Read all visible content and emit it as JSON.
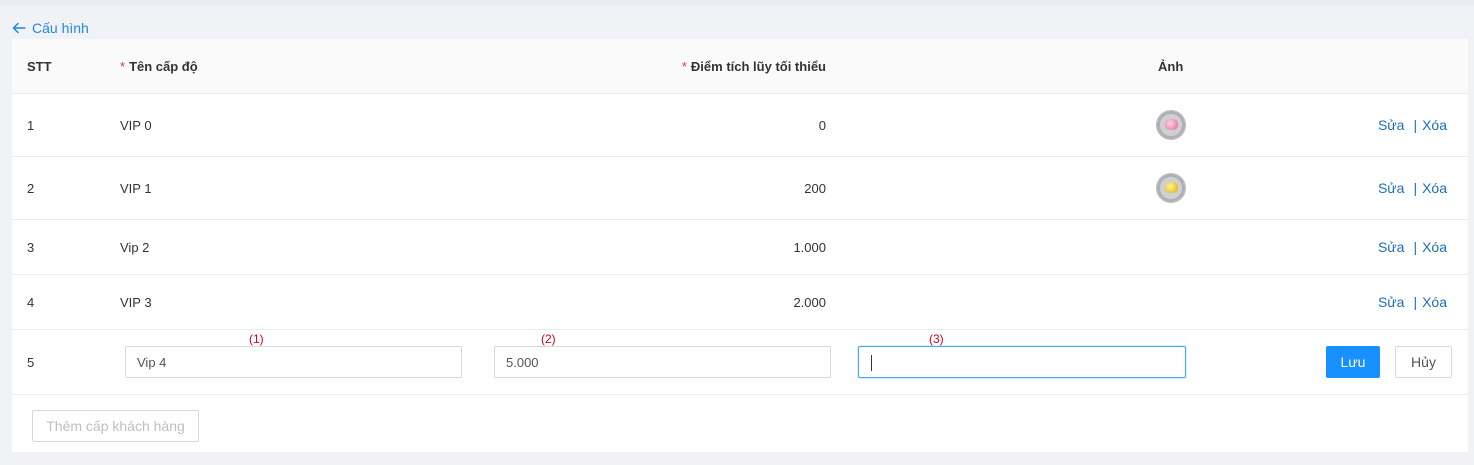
{
  "nav": {
    "back_label": "Cấu hình"
  },
  "table": {
    "headers": {
      "stt": "STT",
      "name": "Tên cấp độ",
      "points": "Điểm tích lũy tối thiểu",
      "image": "Ảnh",
      "required_mark": "*"
    },
    "rows": [
      {
        "stt": "1",
        "name": "VIP 0",
        "points": "0",
        "image": "pink-gem-icon",
        "edit": "Sửa",
        "delete": "Xóa"
      },
      {
        "stt": "2",
        "name": "VIP 1",
        "points": "200",
        "image": "gold-gem-icon",
        "edit": "Sửa",
        "delete": "Xóa"
      },
      {
        "stt": "3",
        "name": "Vip 2",
        "points": "1.000",
        "image": "",
        "edit": "Sửa",
        "delete": "Xóa"
      },
      {
        "stt": "4",
        "name": "VIP 3",
        "points": "2.000",
        "image": "",
        "edit": "Sửa",
        "delete": "Xóa"
      }
    ],
    "separator": "|",
    "edit_row": {
      "stt": "5",
      "name_value": "Vip 4",
      "points_value": "5.000",
      "image_value": "",
      "annotations": [
        "(1)",
        "(2)",
        "(3)"
      ],
      "save_label": "Lưu",
      "cancel_label": "Hủy"
    }
  },
  "footer": {
    "add_label": "Thêm cấp khách hàng"
  },
  "colors": {
    "accent": "#1890ff",
    "link": "#1e6fb8",
    "required": "#e53935",
    "annotation": "#d0021b"
  }
}
